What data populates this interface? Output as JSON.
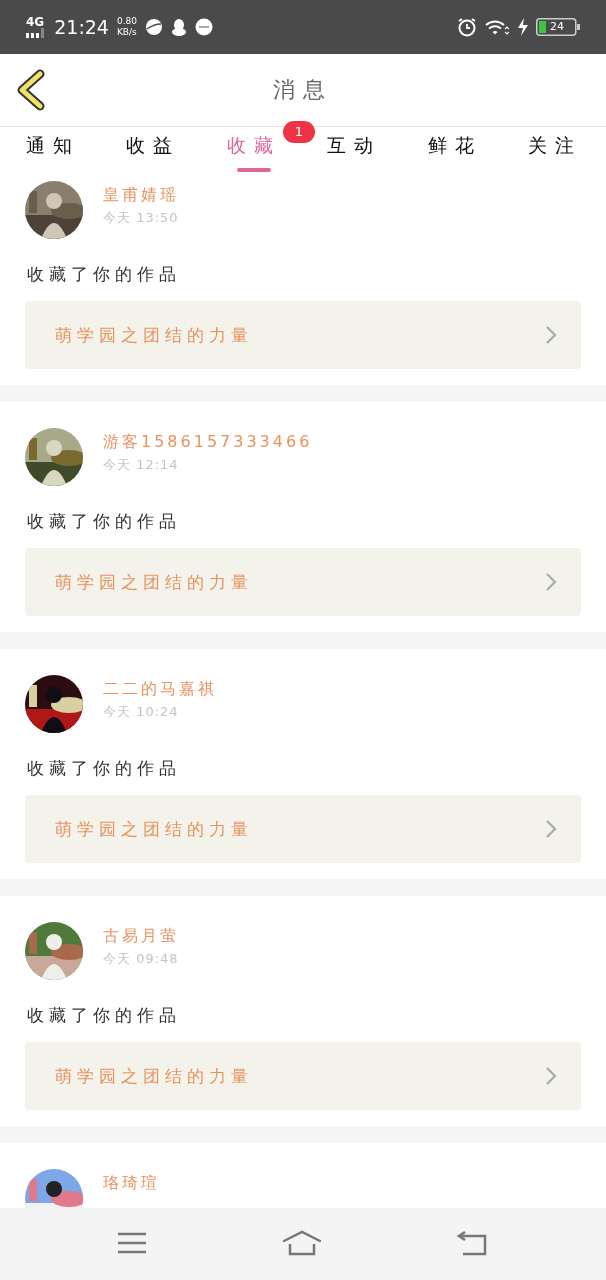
{
  "status_bar": {
    "network": "4G",
    "time": "21:24",
    "speed": "0.80",
    "speed_unit": "KB/s",
    "battery": "24"
  },
  "header": {
    "title": "消息"
  },
  "tabs": [
    {
      "label": "通知",
      "selected": false
    },
    {
      "label": "收益",
      "selected": false
    },
    {
      "label": "收藏",
      "selected": true,
      "badge": "1"
    },
    {
      "label": "互动",
      "selected": false
    },
    {
      "label": "鲜花",
      "selected": false
    },
    {
      "label": "关注",
      "selected": false
    }
  ],
  "messages": [
    {
      "name": "皇甫婧瑶",
      "time": "今天 13:50",
      "action": "收藏了你的作品",
      "work": "萌学园之团结的力量"
    },
    {
      "name": "游客1586157333466",
      "time": "今天 12:14",
      "action": "收藏了你的作品",
      "work": "萌学园之团结的力量"
    },
    {
      "name": "二二的马嘉祺",
      "time": "今天 10:24",
      "action": "收藏了你的作品",
      "work": "萌学园之团结的力量"
    },
    {
      "name": "古易月萤",
      "time": "今天 09:48",
      "action": "收藏了你的作品",
      "work": "萌学园之团结的力量"
    },
    {
      "name": "珞琦瑄"
    }
  ]
}
